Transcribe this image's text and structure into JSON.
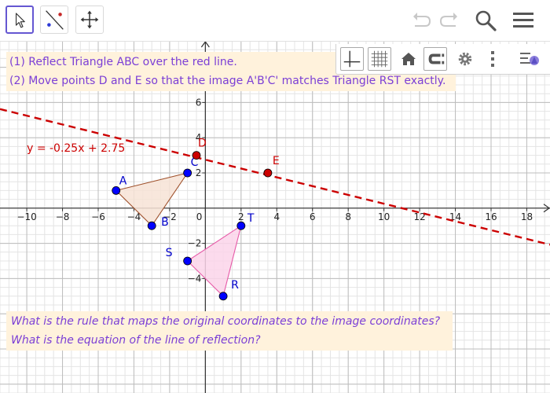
{
  "toolbar": {
    "tools": [
      {
        "name": "move-tool",
        "active": true
      },
      {
        "name": "line-of-reflection-tool",
        "active": false
      },
      {
        "name": "move-graphics-view-tool",
        "active": false
      }
    ],
    "icons": [
      "undo-icon",
      "redo-icon",
      "search-icon",
      "menu-icon"
    ]
  },
  "style_bar": {
    "buttons": [
      "show-axes",
      "show-grid",
      "standard-view",
      "point-capturing",
      "graphics-settings",
      "more-options",
      "toggle-style-bar"
    ]
  },
  "instructions": {
    "line1": "(1) Reflect Triangle ABC over the red line.",
    "line2": "(2) Move points D and E so that the image A'B'C' matches Triangle RST exactly."
  },
  "questions": {
    "line1": "What is the rule that maps the original coordinates to the image coordinates?",
    "line2": "What is the equation of the line of reflection?"
  },
  "graph": {
    "x_range": [
      -11.5,
      19.3
    ],
    "y_range": [
      -10.5,
      9.5
    ],
    "x_ticks": [
      -10,
      -8,
      -6,
      -4,
      -2,
      0,
      2,
      4,
      6,
      8,
      10,
      12,
      14,
      16,
      18
    ],
    "x_tick_labels": [
      "−10",
      "−8",
      "−6",
      "−4",
      "−2",
      "0",
      "2",
      "4",
      "6",
      "8",
      "10",
      "12",
      "14",
      "16",
      "18"
    ],
    "y_ticks": [
      -4,
      -2,
      2,
      4,
      6
    ],
    "y_tick_labels": [
      "−4",
      "−2",
      "2",
      "4",
      "6"
    ],
    "line": {
      "slope": -0.25,
      "intercept": 2.75,
      "color": "#cc0000",
      "label": "y = -0.25x + 2.75",
      "label_pos": [
        -10,
        3.2
      ]
    },
    "triangle_abc": {
      "fill": "#f7e3d6",
      "stroke": "#a0522d"
    },
    "triangle_rst": {
      "fill": "#fbd5ea",
      "stroke": "#e75aa8"
    },
    "points": [
      {
        "label": "A",
        "x": -5,
        "y": 1,
        "color": "#0000ff",
        "label_color": "#0000cc",
        "dx": 4,
        "dy": -8
      },
      {
        "label": "B",
        "x": -3,
        "y": -1,
        "color": "#0000ff",
        "label_color": "#0000cc",
        "dx": 12,
        "dy": 0
      },
      {
        "label": "C",
        "x": -1,
        "y": 2,
        "color": "#0000ff",
        "label_color": "#0000cc",
        "dx": 4,
        "dy": -9
      },
      {
        "label": "S",
        "x": -1,
        "y": -3,
        "color": "#0000ff",
        "label_color": "#0000cc",
        "dx": -28,
        "dy": -6
      },
      {
        "label": "T",
        "x": 2,
        "y": -1,
        "color": "#0000ff",
        "label_color": "#0000cc",
        "dx": 8,
        "dy": -5
      },
      {
        "label": "R",
        "x": 1,
        "y": -5,
        "color": "#0000ff",
        "label_color": "#0000cc",
        "dx": 10,
        "dy": -10
      },
      {
        "label": "D",
        "x": -0.5,
        "y": 3,
        "color": "#cc0000",
        "label_color": "#cc0000",
        "dx": 2,
        "dy": -11
      },
      {
        "label": "E",
        "x": 3.5,
        "y": 2,
        "color": "#cc0000",
        "label_color": "#cc0000",
        "dx": 6,
        "dy": -11
      }
    ]
  }
}
